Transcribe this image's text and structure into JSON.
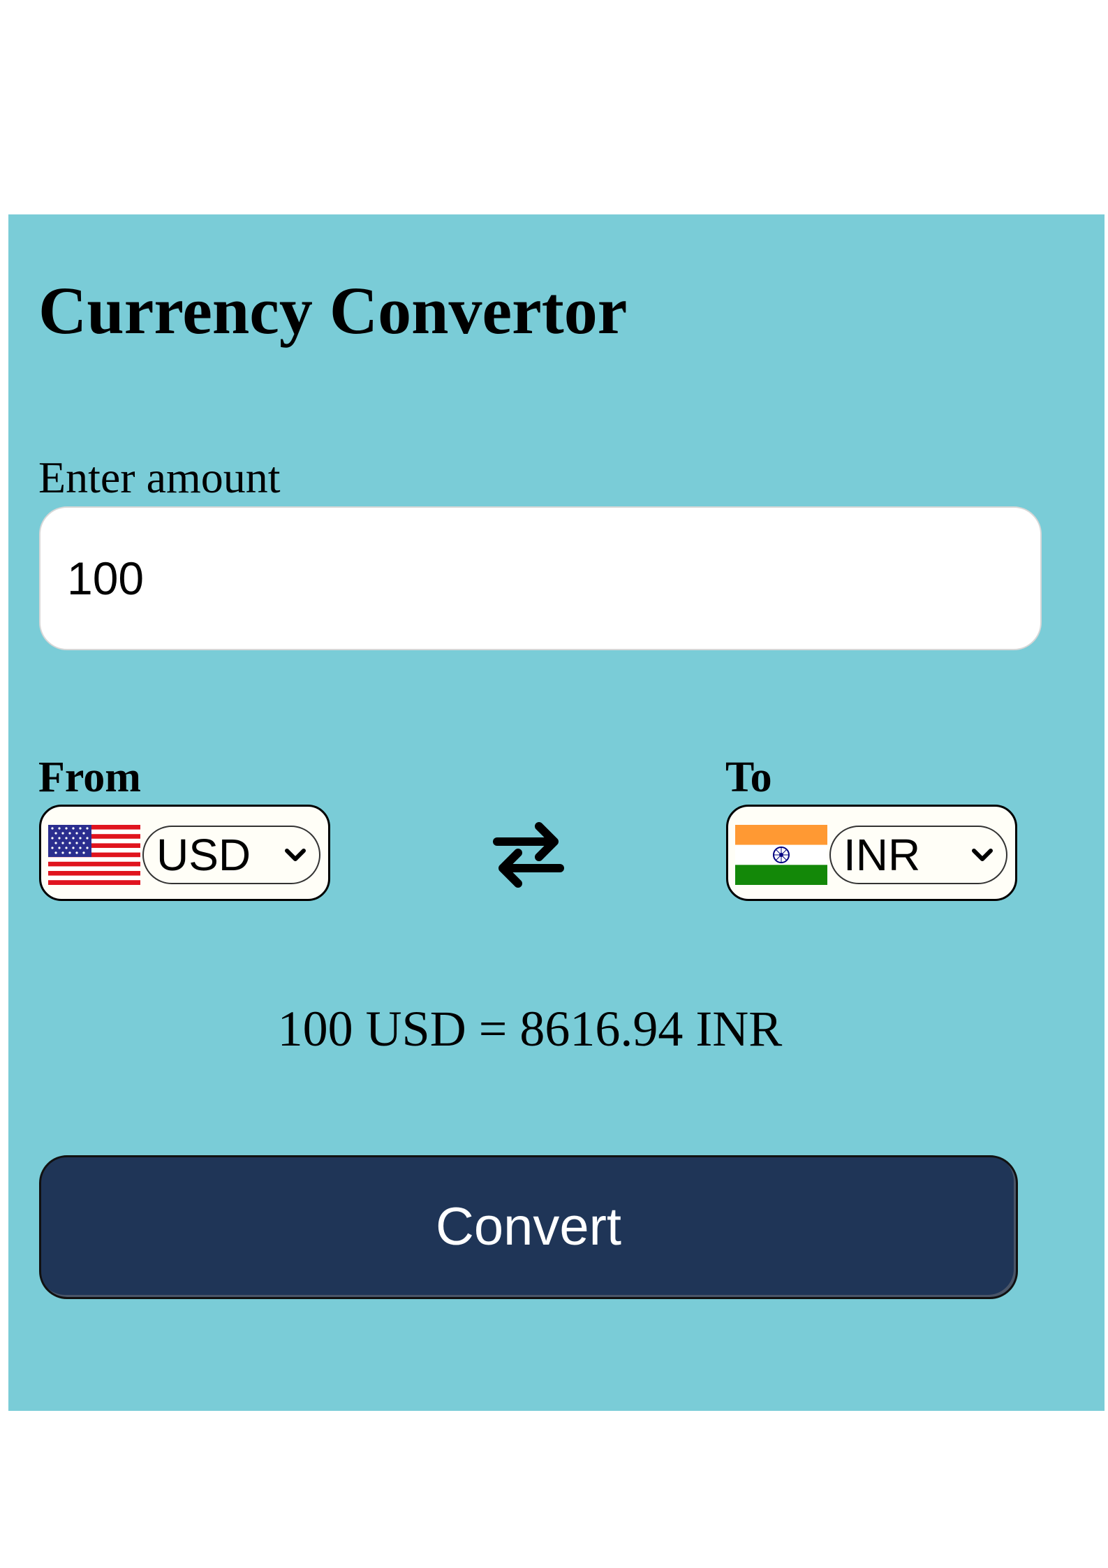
{
  "app": {
    "title": "Currency Convertor"
  },
  "amount": {
    "label": "Enter amount",
    "value": "100"
  },
  "from": {
    "label": "From",
    "currency": "USD",
    "flag_icon": "us-flag-icon"
  },
  "to": {
    "label": "To",
    "currency": "INR",
    "flag_icon": "india-flag-icon"
  },
  "swap": {
    "icon": "swap-arrows-icon"
  },
  "result": {
    "text": "100 USD = 8616.94 INR"
  },
  "actions": {
    "convert_label": "Convert"
  },
  "colors": {
    "card_background": "#7accd7",
    "button_background": "#1f3557",
    "button_text": "#ffffff"
  }
}
